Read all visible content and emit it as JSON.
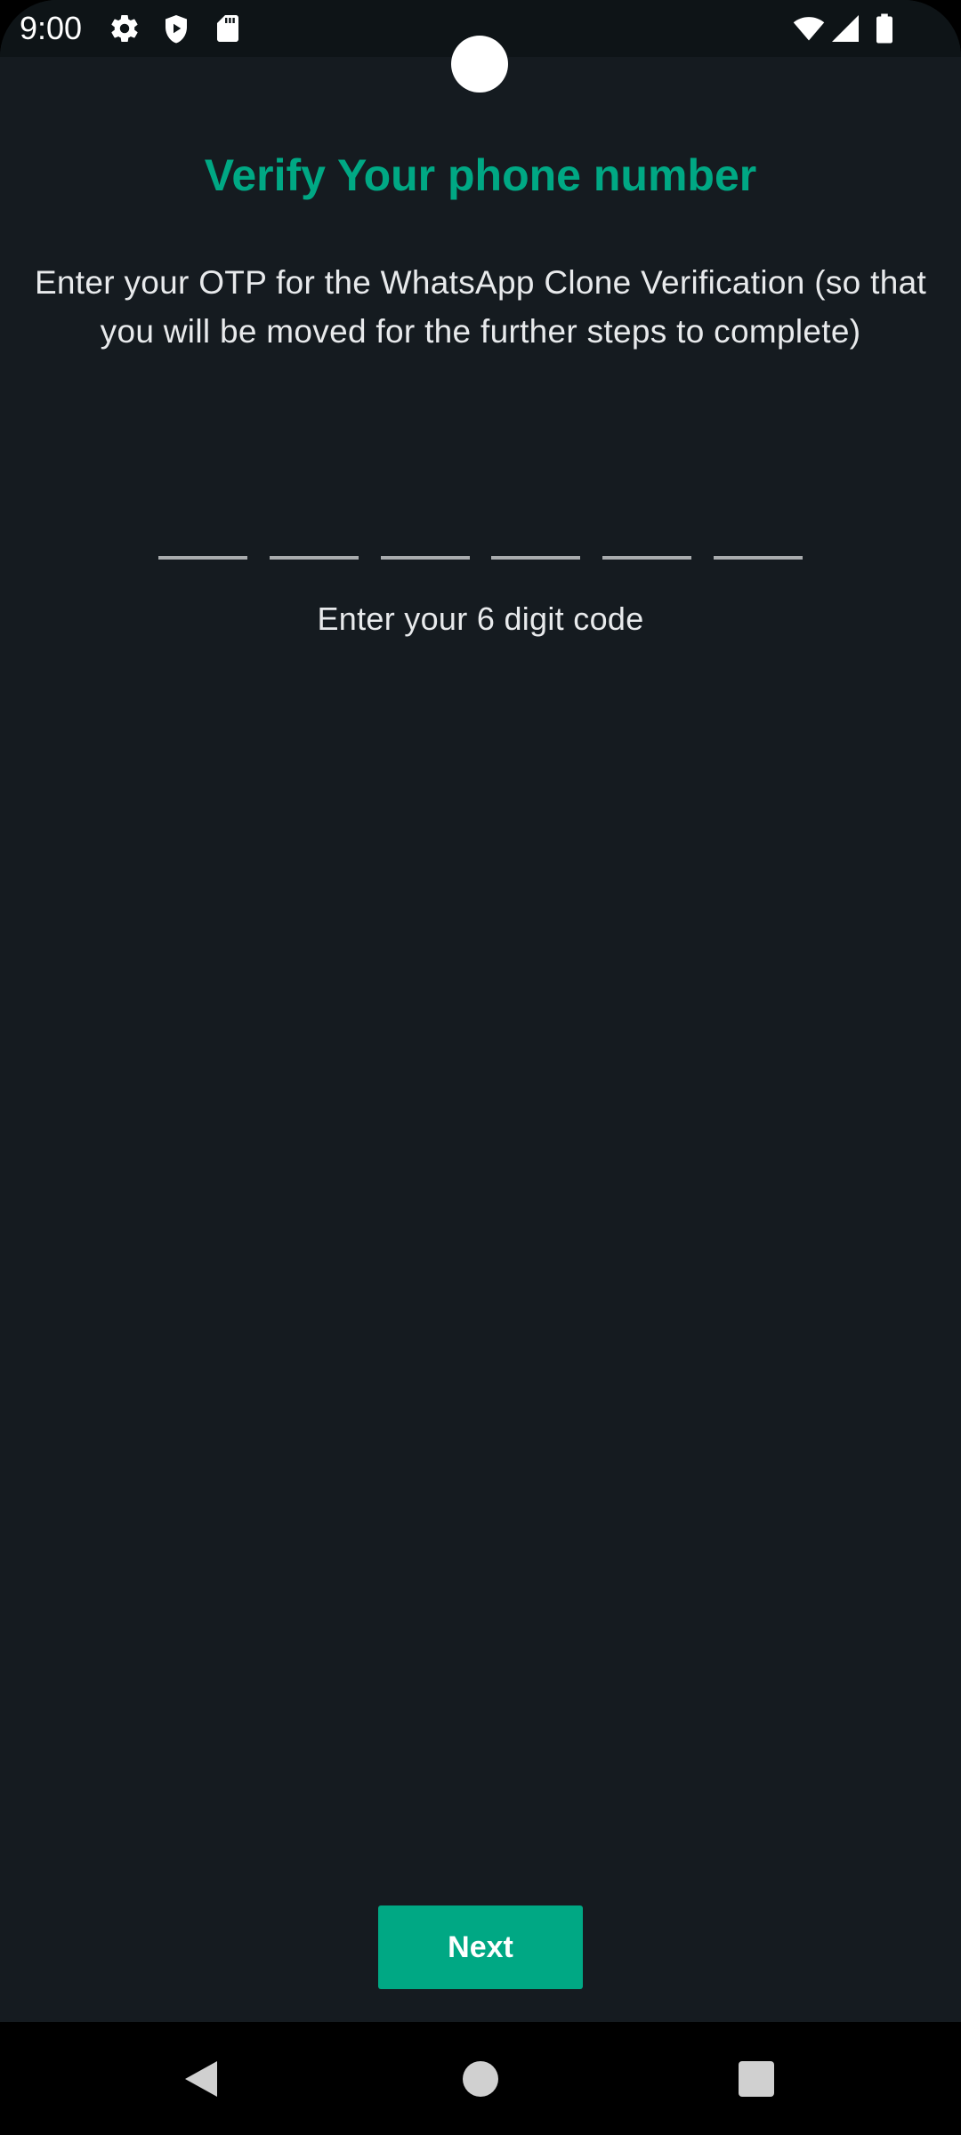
{
  "status_bar": {
    "time": "9:00",
    "left_icons": [
      "gear-icon",
      "shield-play-icon",
      "sd-card-icon"
    ],
    "right_icons": [
      "wifi-icon",
      "signal-icon",
      "battery-icon"
    ]
  },
  "main": {
    "title": "Verify Your phone number",
    "description": "Enter your OTP for the WhatsApp Clone Verification (so that you will be moved for the further steps to complete)",
    "otp": {
      "digit_count": 6,
      "values": [
        "",
        "",
        "",
        "",
        "",
        ""
      ],
      "hint": "Enter your 6 digit code"
    },
    "next_label": "Next"
  },
  "nav_bar": {
    "icons": [
      "back-icon",
      "home-icon",
      "recents-icon"
    ]
  },
  "colors": {
    "background": "#151b20",
    "accent": "#00a884",
    "text": "#e8eaec",
    "underline": "#a9acae"
  }
}
